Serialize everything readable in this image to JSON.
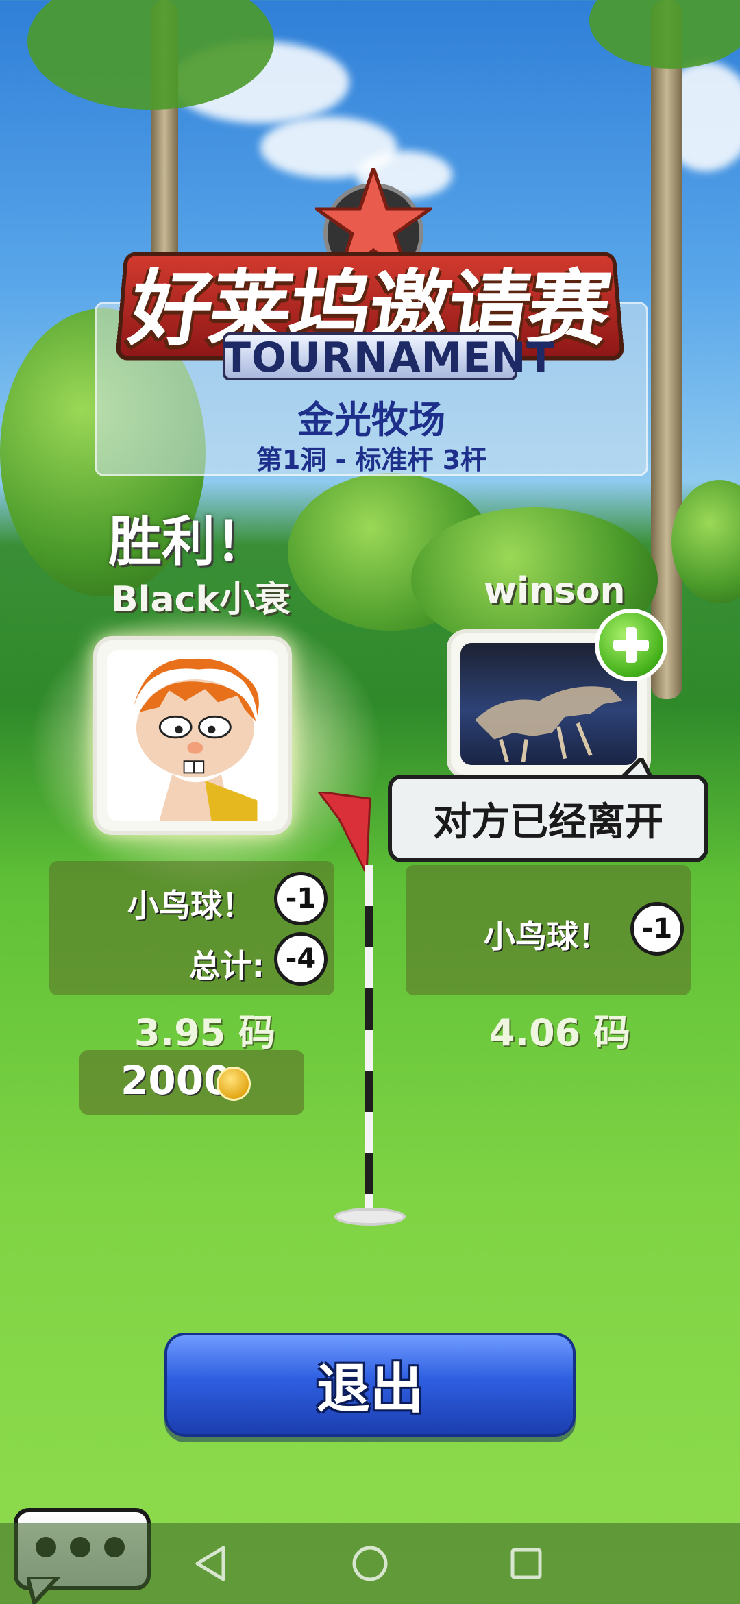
{
  "header": {
    "title_cn": "好莱坞邀请赛",
    "title_en": "TOURNAMENT",
    "course": "金光牧场",
    "hole_info": "第1洞 - 标准杆 3杆"
  },
  "result": {
    "victory_text": "胜利！"
  },
  "player_left": {
    "name": "Black小衰",
    "score_label_1": "小鸟球！",
    "score_value_1": "-1",
    "score_label_2": "总计:",
    "score_value_2": "-4",
    "distance": "3.95 码",
    "coins": "2000"
  },
  "player_right": {
    "name": "winson",
    "status_bubble": "对方已经离开",
    "score_label_1": "小鸟球！",
    "score_value_1": "-1",
    "distance": "4.06 码"
  },
  "actions": {
    "exit_label": "退出"
  },
  "icons": {
    "add_friend": "plus-icon",
    "coin": "crown-coin-icon",
    "chat": "chat-bubble-icon",
    "nav_back": "triangle-back-icon",
    "nav_home": "circle-home-icon",
    "nav_recents": "square-recents-icon"
  },
  "colors": {
    "exit_button": "#2e5ee0",
    "course_text": "#1d2f8a",
    "plus_button": "#43b019",
    "flag": "#d9303a"
  }
}
